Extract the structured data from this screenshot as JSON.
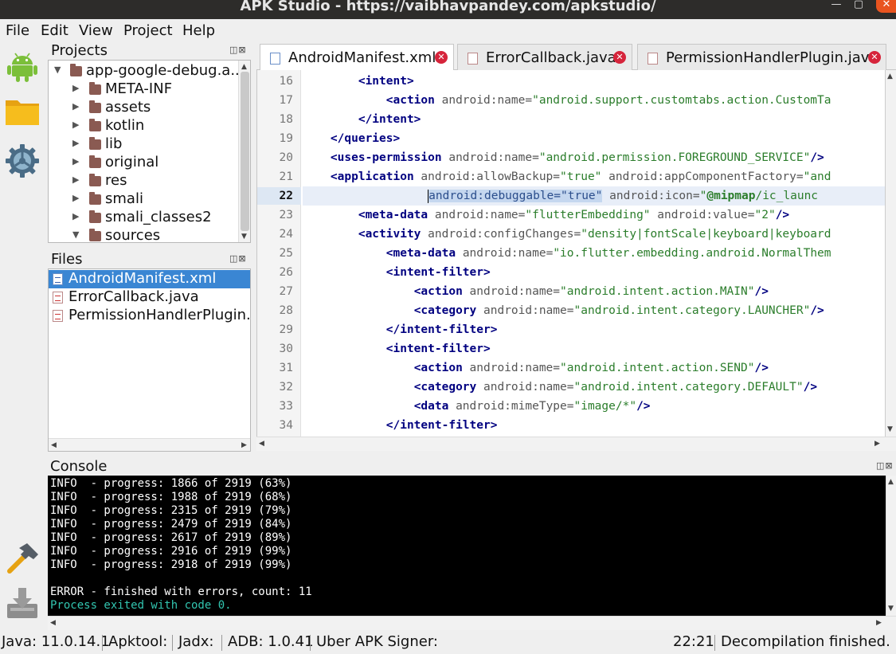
{
  "window": {
    "title": "APK Studio - https://vaibhavpandey.com/apkstudio/",
    "minimize_glyph": "—",
    "maximize_glyph": "▢",
    "close_glyph": "✕"
  },
  "menubar": {
    "items": [
      "File",
      "Edit",
      "View",
      "Project",
      "Help"
    ]
  },
  "sidebar_tools": [
    "android-icon",
    "folder-icon",
    "gear-icon",
    "hammer-icon",
    "download-icon"
  ],
  "projects": {
    "title": "Projects",
    "dock_buttons": "◫⊠",
    "root": "app-google-debug.a...",
    "children": [
      "META-INF",
      "assets",
      "kotlin",
      "lib",
      "original",
      "res",
      "smali",
      "smali_classes2",
      "sources"
    ],
    "expanded_indices": [
      8
    ]
  },
  "files": {
    "title": "Files",
    "dock_buttons": "◫⊠",
    "items": [
      {
        "name": "AndroidManifest.xml",
        "type": "xml",
        "selected": true
      },
      {
        "name": "ErrorCallback.java",
        "type": "java",
        "selected": false
      },
      {
        "name": "PermissionHandlerPlugin.jav",
        "type": "java",
        "selected": false
      }
    ]
  },
  "tabs": [
    {
      "label": "AndroidManifest.xml",
      "type": "xml",
      "active": true,
      "close_glyph": "✕"
    },
    {
      "label": "ErrorCallback.java",
      "type": "java",
      "active": false,
      "close_glyph": "✕"
    },
    {
      "label": "PermissionHandlerPlugin.java",
      "type": "java",
      "active": false,
      "close_glyph": "✕"
    }
  ],
  "editor": {
    "current_line": 22,
    "lines": [
      {
        "num": "16",
        "parts": [
          [
            "t",
            "        "
          ],
          [
            "tag",
            "<intent>"
          ]
        ]
      },
      {
        "num": "17",
        "parts": [
          [
            "t",
            "            "
          ],
          [
            "tag",
            "<action"
          ],
          [
            "t",
            " "
          ],
          [
            "attr",
            "android:name="
          ],
          [
            "val",
            "\"android.support.customtabs.action.CustomTa"
          ]
        ]
      },
      {
        "num": "18",
        "parts": [
          [
            "t",
            "        "
          ],
          [
            "tag",
            "</intent>"
          ]
        ]
      },
      {
        "num": "19",
        "parts": [
          [
            "t",
            "    "
          ],
          [
            "tag",
            "</queries>"
          ]
        ]
      },
      {
        "num": "20",
        "parts": [
          [
            "t",
            "    "
          ],
          [
            "tag",
            "<uses-permission"
          ],
          [
            "t",
            " "
          ],
          [
            "attr",
            "android:name="
          ],
          [
            "val",
            "\"android.permission.FOREGROUND_SERVICE\""
          ],
          [
            "tag",
            "/>"
          ]
        ]
      },
      {
        "num": "21",
        "parts": [
          [
            "t",
            "    "
          ],
          [
            "tag",
            "<application"
          ],
          [
            "t",
            " "
          ],
          [
            "attr",
            "android:allowBackup="
          ],
          [
            "val",
            "\"true\""
          ],
          [
            "t",
            " "
          ],
          [
            "attr",
            "android:appComponentFactory="
          ],
          [
            "val",
            "\"and"
          ]
        ]
      },
      {
        "num": "22",
        "parts": [
          [
            "t",
            "                  "
          ],
          [
            "caret",
            ""
          ],
          [
            "sel",
            "android:debuggable=\"true\""
          ],
          [
            "t",
            " "
          ],
          [
            "attr",
            "android:icon="
          ],
          [
            "val",
            "\""
          ],
          [
            "bold",
            "@mipmap"
          ],
          [
            "val",
            "/ic_launc"
          ]
        ]
      },
      {
        "num": "23",
        "parts": [
          [
            "t",
            "        "
          ],
          [
            "tag",
            "<meta-data"
          ],
          [
            "t",
            " "
          ],
          [
            "attr",
            "android:name="
          ],
          [
            "val",
            "\"flutterEmbedding\""
          ],
          [
            "t",
            " "
          ],
          [
            "attr",
            "android:value="
          ],
          [
            "val",
            "\"2\""
          ],
          [
            "tag",
            "/>"
          ]
        ]
      },
      {
        "num": "24",
        "parts": [
          [
            "t",
            "        "
          ],
          [
            "tag",
            "<activity"
          ],
          [
            "t",
            " "
          ],
          [
            "attr",
            "android:configChanges="
          ],
          [
            "val",
            "\"density|fontScale|keyboard|keyboard"
          ]
        ]
      },
      {
        "num": "25",
        "parts": [
          [
            "t",
            "            "
          ],
          [
            "tag",
            "<meta-data"
          ],
          [
            "t",
            " "
          ],
          [
            "attr",
            "android:name="
          ],
          [
            "val",
            "\"io.flutter.embedding.android.NormalThem"
          ]
        ]
      },
      {
        "num": "26",
        "parts": [
          [
            "t",
            "            "
          ],
          [
            "tag",
            "<intent-filter>"
          ]
        ]
      },
      {
        "num": "27",
        "parts": [
          [
            "t",
            "                "
          ],
          [
            "tag",
            "<action"
          ],
          [
            "t",
            " "
          ],
          [
            "attr",
            "android:name="
          ],
          [
            "val",
            "\"android.intent.action.MAIN\""
          ],
          [
            "tag",
            "/>"
          ]
        ]
      },
      {
        "num": "28",
        "parts": [
          [
            "t",
            "                "
          ],
          [
            "tag",
            "<category"
          ],
          [
            "t",
            " "
          ],
          [
            "attr",
            "android:name="
          ],
          [
            "val",
            "\"android.intent.category.LAUNCHER\""
          ],
          [
            "tag",
            "/>"
          ]
        ]
      },
      {
        "num": "29",
        "parts": [
          [
            "t",
            "            "
          ],
          [
            "tag",
            "</intent-filter>"
          ]
        ]
      },
      {
        "num": "30",
        "parts": [
          [
            "t",
            "            "
          ],
          [
            "tag",
            "<intent-filter>"
          ]
        ]
      },
      {
        "num": "31",
        "parts": [
          [
            "t",
            "                "
          ],
          [
            "tag",
            "<action"
          ],
          [
            "t",
            " "
          ],
          [
            "attr",
            "android:name="
          ],
          [
            "val",
            "\"android.intent.action.SEND\""
          ],
          [
            "tag",
            "/>"
          ]
        ]
      },
      {
        "num": "32",
        "parts": [
          [
            "t",
            "                "
          ],
          [
            "tag",
            "<category"
          ],
          [
            "t",
            " "
          ],
          [
            "attr",
            "android:name="
          ],
          [
            "val",
            "\"android.intent.category.DEFAULT\""
          ],
          [
            "tag",
            "/>"
          ]
        ]
      },
      {
        "num": "33",
        "parts": [
          [
            "t",
            "                "
          ],
          [
            "tag",
            "<data"
          ],
          [
            "t",
            " "
          ],
          [
            "attr",
            "android:mimeType="
          ],
          [
            "val",
            "\"image/*\""
          ],
          [
            "tag",
            "/>"
          ]
        ]
      },
      {
        "num": "34",
        "parts": [
          [
            "t",
            "            "
          ],
          [
            "tag",
            "</intent-filter>"
          ]
        ]
      }
    ]
  },
  "console": {
    "title": "Console",
    "dock_buttons": "◫⊠",
    "lines": [
      {
        "text": "INFO  - progress: 1866 of 2919 (63%)",
        "kind": "info"
      },
      {
        "text": "INFO  - progress: 1988 of 2919 (68%)",
        "kind": "info"
      },
      {
        "text": "INFO  - progress: 2315 of 2919 (79%)",
        "kind": "info"
      },
      {
        "text": "INFO  - progress: 2479 of 2919 (84%)",
        "kind": "info"
      },
      {
        "text": "INFO  - progress: 2617 of 2919 (89%)",
        "kind": "info"
      },
      {
        "text": "INFO  - progress: 2916 of 2919 (99%)",
        "kind": "info"
      },
      {
        "text": "INFO  - progress: 2918 of 2919 (99%)",
        "kind": "info"
      },
      {
        "text": "",
        "kind": "info"
      },
      {
        "text": "ERROR - finished with errors, count: 11",
        "kind": "info"
      },
      {
        "text": "Process exited with code 0.",
        "kind": "ok"
      }
    ]
  },
  "statusbar": {
    "java": "Java: 11.0.14.1",
    "apktool": "Apktool:",
    "jadx": "Jadx:",
    "adb": "ADB: 1.0.41",
    "signer": "Uber APK Signer:",
    "cursor": "22:21",
    "message": "Decompilation finished."
  },
  "colors": {
    "selection": "#3a86d3",
    "tag": "#000080",
    "value": "#2b7d2b",
    "close_tab": "#d6243b",
    "console_ok": "#32c5b0"
  }
}
